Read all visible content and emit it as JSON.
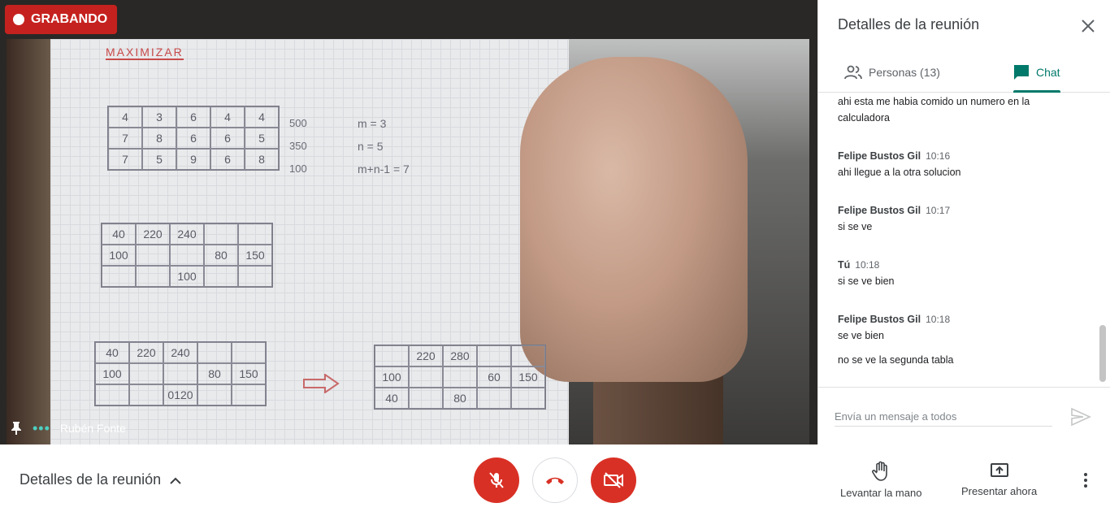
{
  "recording": {
    "label": "GRABANDO"
  },
  "participant": {
    "name": "Rubén Fonte"
  },
  "video": {
    "sheet_title": "MAXIMIZAR",
    "table1": [
      [
        "4",
        "3",
        "6",
        "4",
        "4"
      ],
      [
        "7",
        "8",
        "6",
        "6",
        "5"
      ],
      [
        "7",
        "5",
        "9",
        "6",
        "8"
      ]
    ],
    "table1_side": [
      "500",
      "350",
      "100"
    ],
    "table1_notes": [
      "m = 3",
      "n = 5",
      "m+n-1 = 7"
    ],
    "table2": [
      [
        "40",
        "220",
        "240",
        "",
        ""
      ],
      [
        "100",
        "",
        "",
        "80",
        "150"
      ],
      [
        "",
        "",
        "100",
        "",
        ""
      ]
    ],
    "table3": [
      [
        "40",
        "220",
        "240",
        "",
        ""
      ],
      [
        "100",
        "",
        "",
        "80",
        "150"
      ],
      [
        "",
        "",
        "0120",
        "",
        ""
      ]
    ],
    "table4": [
      [
        "",
        "220",
        "280",
        "",
        ""
      ],
      [
        "100",
        "",
        "",
        "60",
        "150"
      ],
      [
        "40",
        "",
        "80",
        "",
        ""
      ]
    ]
  },
  "panel": {
    "title": "Detalles de la reunión",
    "tabs": {
      "people": "Personas (13)",
      "chat": "Chat"
    },
    "messages": [
      {
        "sender": "",
        "time": "",
        "lines": [
          "ahi esta me habia comido un numero en la calculadora"
        ]
      },
      {
        "sender": "Felipe Bustos Gil",
        "time": "10:16",
        "lines": [
          "ahi llegue a la otra solucion"
        ]
      },
      {
        "sender": "Felipe Bustos Gil",
        "time": "10:17",
        "lines": [
          "si se ve"
        ]
      },
      {
        "sender": "Tú",
        "time": "10:18",
        "lines": [
          "si se ve bien"
        ]
      },
      {
        "sender": "Felipe Bustos Gil",
        "time": "10:18",
        "lines": [
          "se ve bien",
          "no se ve la segunda tabla"
        ]
      }
    ],
    "composer_placeholder": "Envía un mensaje a todos"
  },
  "bottom": {
    "details_label": "Detalles de la reunión",
    "raise_hand": "Levantar la mano",
    "present_now": "Presentar ahora"
  },
  "colors": {
    "recording": "#c5221f",
    "control_red": "#d93025",
    "accent": "#00796b"
  }
}
